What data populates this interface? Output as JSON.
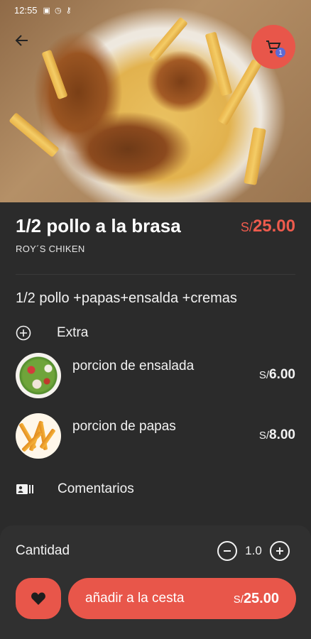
{
  "status_bar": {
    "time": "12:55"
  },
  "cart": {
    "badge_count": "1"
  },
  "product": {
    "name": "1/2 pollo a la brasa",
    "currency": "S/",
    "price": "25.00",
    "restaurant": "ROY´S CHIKEN",
    "description": "1/2 pollo +papas+ensalda +cremas"
  },
  "extras": {
    "label": "Extra",
    "items": [
      {
        "name": "porcion de ensalada",
        "currency": "S/",
        "price": "6.00"
      },
      {
        "name": "porcion de papas",
        "currency": "S/",
        "price": "8.00"
      }
    ]
  },
  "comments": {
    "label": "Comentarios"
  },
  "quantity": {
    "label": "Cantidad",
    "value": "1.0"
  },
  "cta": {
    "label": "añadir a la cesta",
    "currency": "S/",
    "price": "25.00"
  },
  "colors": {
    "accent": "#e8564a",
    "price_text": "#ee5b4d",
    "background": "#2b2b2b",
    "panel": "#303030"
  },
  "icons": [
    "arrow-left-icon",
    "cart-icon",
    "plus-circle-icon",
    "comment-icon",
    "minus-circle-icon",
    "heart-icon"
  ]
}
